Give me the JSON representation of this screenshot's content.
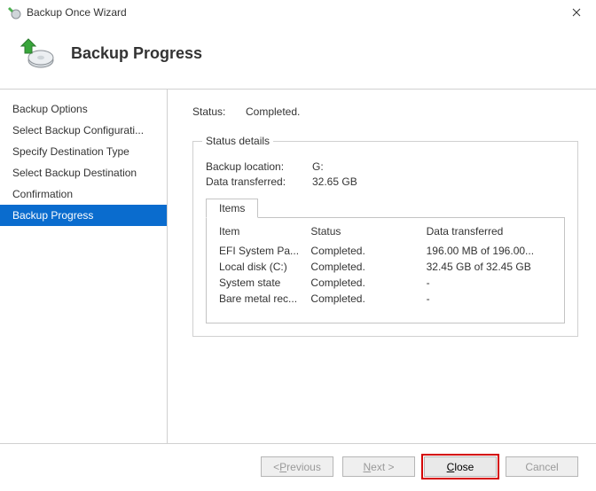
{
  "window": {
    "title": "Backup Once Wizard"
  },
  "header": {
    "title": "Backup Progress"
  },
  "sidebar": {
    "items": [
      {
        "label": "Backup Options"
      },
      {
        "label": "Select Backup Configurati..."
      },
      {
        "label": "Specify Destination Type"
      },
      {
        "label": "Select Backup Destination"
      },
      {
        "label": "Confirmation"
      },
      {
        "label": "Backup Progress"
      }
    ],
    "selected_index": 5
  },
  "status": {
    "label": "Status:",
    "value": "Completed."
  },
  "details": {
    "legend": "Status details",
    "location_label": "Backup location:",
    "location_value": "G:",
    "transferred_label": "Data transferred:",
    "transferred_value": "32.65 GB",
    "tab_label": "Items",
    "columns": {
      "c1": "Item",
      "c2": "Status",
      "c3": "Data transferred"
    },
    "rows": [
      {
        "item": "EFI System Pa...",
        "status": "Completed.",
        "data": "196.00 MB of 196.00..."
      },
      {
        "item": "Local disk (C:)",
        "status": "Completed.",
        "data": "32.45 GB of 32.45 GB"
      },
      {
        "item": "System state",
        "status": "Completed.",
        "data": "-"
      },
      {
        "item": "Bare metal rec...",
        "status": "Completed.",
        "data": "-"
      }
    ]
  },
  "buttons": {
    "previous_prefix": "< ",
    "previous_accel": "P",
    "previous_rest": "revious",
    "next_accel": "N",
    "next_rest": "ext >",
    "close_accel": "C",
    "close_rest": "lose",
    "cancel": "Cancel"
  }
}
